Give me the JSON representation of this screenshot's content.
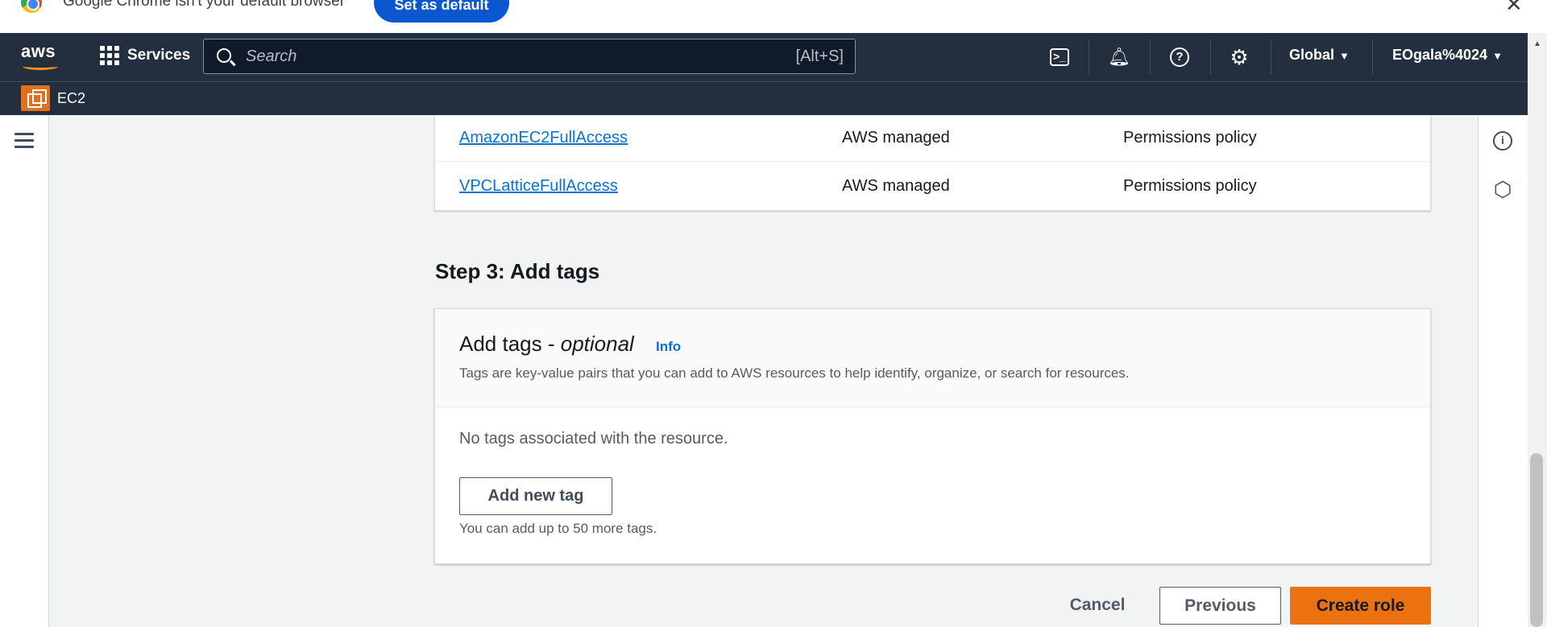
{
  "browser_infobar": {
    "message": "Google Chrome isn't your default browser",
    "set_default_label": "Set as default"
  },
  "topnav": {
    "logo_text": "aws",
    "services_label": "Services",
    "search_placeholder": "Search",
    "search_shortcut": "[Alt+S]",
    "region_label": "Global",
    "account_label": "EOgala%4024"
  },
  "service_bar": {
    "service_name": "EC2"
  },
  "permissions": {
    "rows": [
      {
        "name": "AmazonEC2FullAccess",
        "type": "AWS managed",
        "used_as": "Permissions policy"
      },
      {
        "name": "VPCLatticeFullAccess",
        "type": "AWS managed",
        "used_as": "Permissions policy"
      }
    ]
  },
  "step3": {
    "heading": "Step 3: Add tags",
    "panel_title": "Add tags - ",
    "panel_title_optional": "optional",
    "info_link": "Info",
    "description": "Tags are key-value pairs that you can add to AWS resources to help identify, organize, or search for resources.",
    "empty_message": "No tags associated with the resource.",
    "add_tag_label": "Add new tag",
    "limit_text": "You can add up to 50 more tags."
  },
  "footer_actions": {
    "cancel_label": "Cancel",
    "previous_label": "Previous",
    "create_label": "Create role"
  },
  "colors": {
    "nav_bg": "#232f3e",
    "link": "#0972d3",
    "primary_button": "#ec7211",
    "service_icon": "#e0711c"
  }
}
